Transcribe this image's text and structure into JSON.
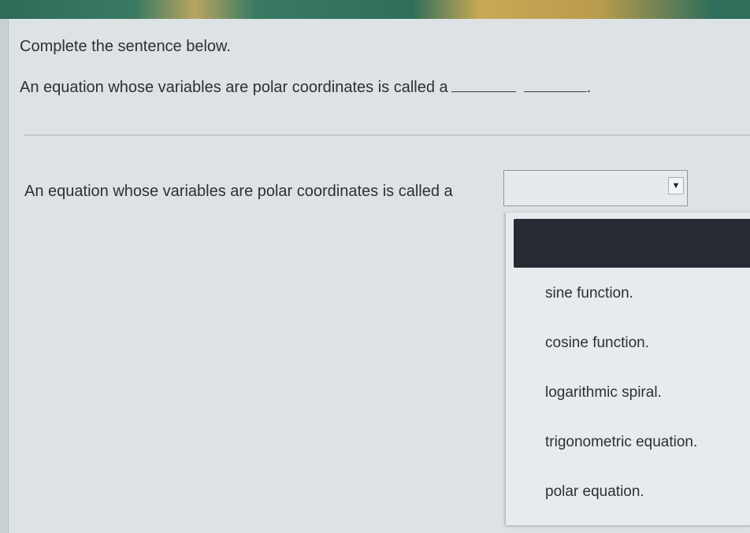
{
  "question": {
    "instruction": "Complete the sentence below.",
    "sentence": "An equation whose variables are polar coordinates is called a",
    "trailing_punctuation": "."
  },
  "answer": {
    "sentence": "An equation whose variables are polar coordinates is called a",
    "selected_value": "",
    "arrow_icon": "▼"
  },
  "dropdown": {
    "options": [
      "sine function.",
      "cosine function.",
      "logarithmic spiral.",
      "trigonometric equation.",
      "polar equation."
    ]
  }
}
